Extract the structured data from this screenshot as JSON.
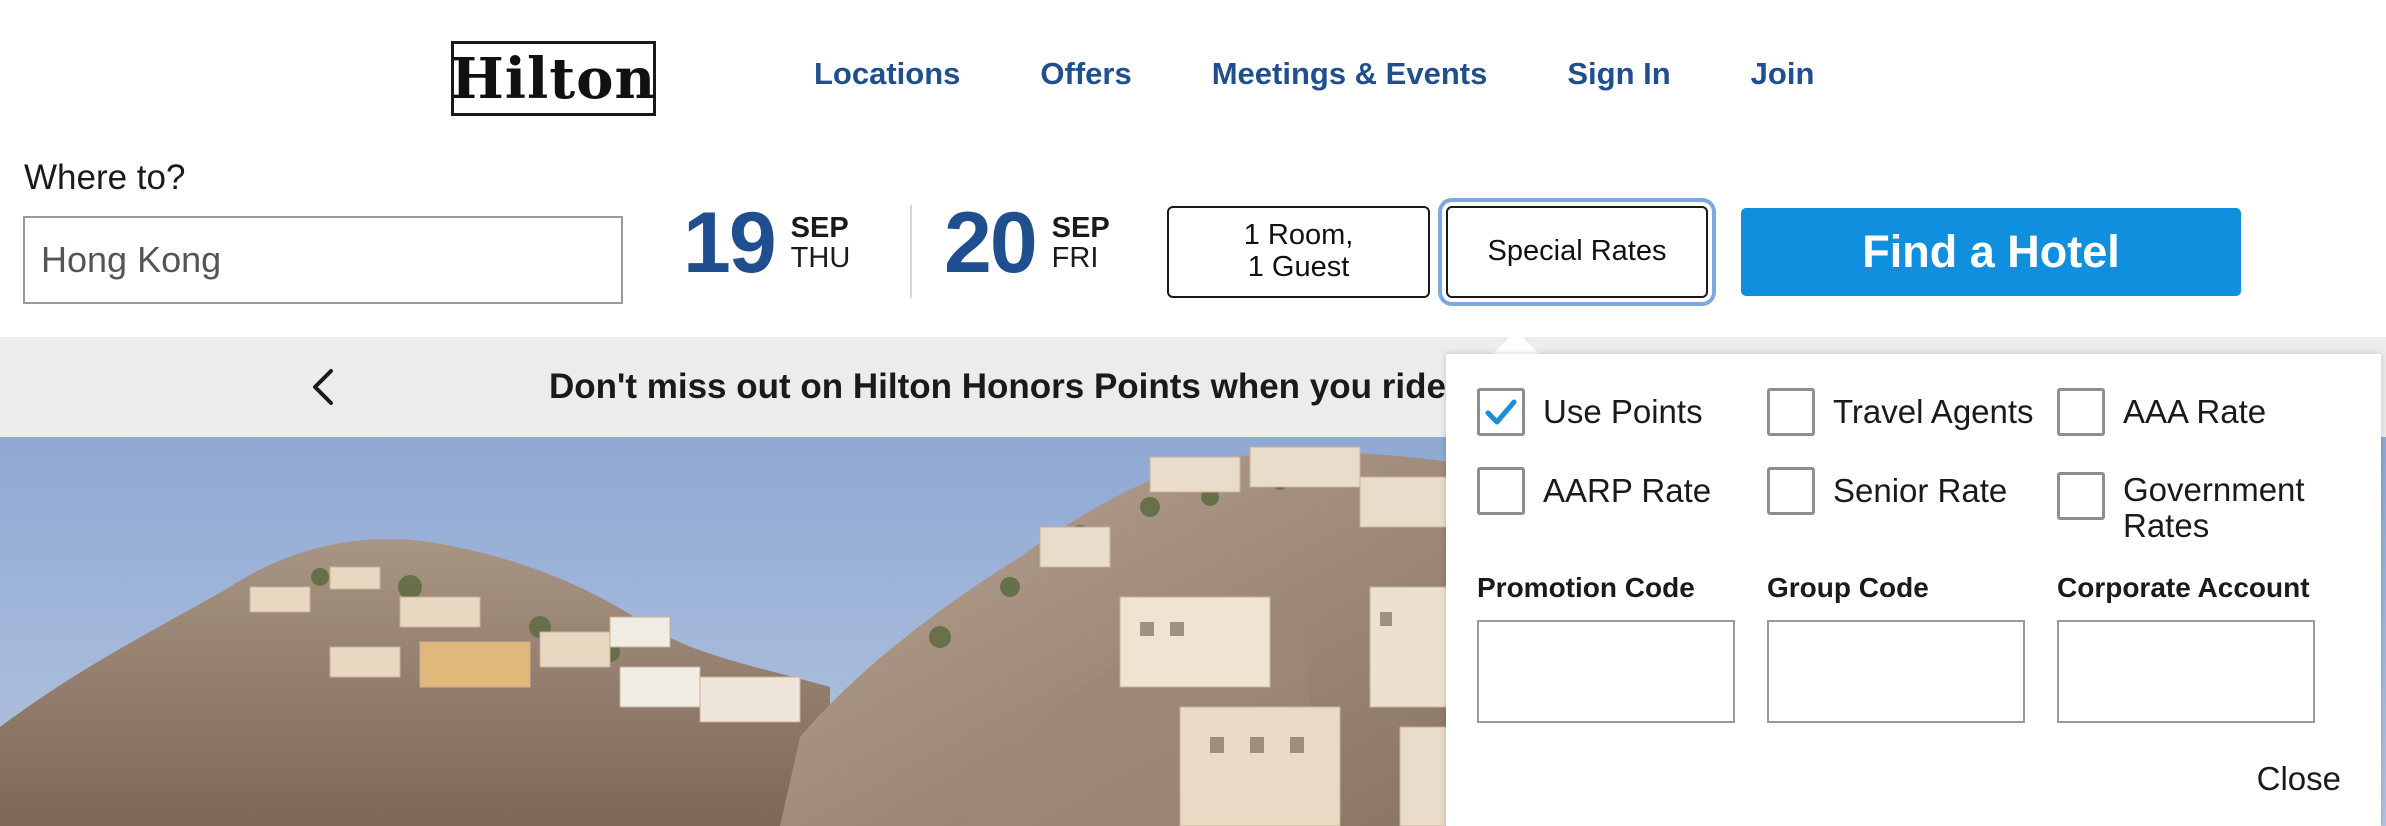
{
  "header": {
    "logo_text": "Hilton",
    "nav": [
      "Locations",
      "Offers",
      "Meetings & Events",
      "Sign In",
      "Join"
    ]
  },
  "search": {
    "where_label": "Where to?",
    "where_value": "Hong Kong",
    "checkin": {
      "day": "19",
      "month": "SEP",
      "weekday": "THU"
    },
    "checkout": {
      "day": "20",
      "month": "SEP",
      "weekday": "FRI"
    },
    "rooms_line1": "1 Room,",
    "rooms_line2": "1 Guest",
    "special_rates_label": "Special Rates",
    "find_label": "Find a Hotel"
  },
  "banner": {
    "text": "Don't miss out on Hilton Honors Points when you ride wi"
  },
  "special_rates": {
    "options": [
      {
        "label": "Use Points",
        "checked": true
      },
      {
        "label": "Travel Agents",
        "checked": false
      },
      {
        "label": "AAA Rate",
        "checked": false
      },
      {
        "label": "AARP Rate",
        "checked": false
      },
      {
        "label": "Senior Rate",
        "checked": false
      },
      {
        "label": "Government Rates",
        "checked": false
      }
    ],
    "codes": [
      "Promotion Code",
      "Group Code",
      "Corporate Account"
    ],
    "close_label": "Close"
  },
  "colors": {
    "brand_blue": "#1f4f8f",
    "cta_blue": "#0f8fde",
    "check_blue": "#1a8fd8"
  }
}
